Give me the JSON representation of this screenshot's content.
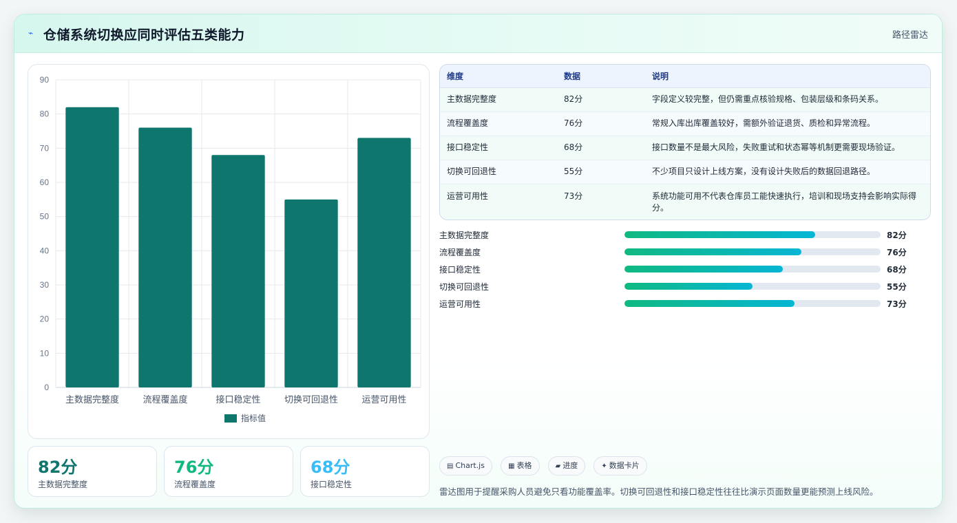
{
  "header": {
    "icon": "bolt-icon",
    "title": "仓储系统切换应同时评估五类能力",
    "tag": "路径雷达"
  },
  "chart_data": {
    "type": "bar",
    "categories": [
      "主数据完整度",
      "流程覆盖度",
      "接口稳定性",
      "切换可回退性",
      "运营可用性"
    ],
    "series": [
      {
        "name": "指标值",
        "values": [
          82,
          76,
          68,
          55,
          73
        ],
        "color": "#0f766e"
      }
    ],
    "ylim": [
      0,
      90
    ],
    "yticks": [
      0,
      10,
      20,
      30,
      40,
      50,
      60,
      70,
      80,
      90
    ],
    "grid": true,
    "legend": "bottom"
  },
  "stats": [
    {
      "value": "82分",
      "label": "主数据完整度",
      "color": "#0f766e"
    },
    {
      "value": "76分",
      "label": "流程覆盖度",
      "color": "#10b981"
    },
    {
      "value": "68分",
      "label": "接口稳定性",
      "color": "#38bdf8"
    }
  ],
  "table": {
    "headers": [
      "维度",
      "数据",
      "说明"
    ],
    "rows": [
      [
        "主数据完整度",
        "82分",
        "字段定义较完整，但仍需重点核验规格、包装层级和条码关系。"
      ],
      [
        "流程覆盖度",
        "76分",
        "常规入库出库覆盖较好，需额外验证退货、质检和异常流程。"
      ],
      [
        "接口稳定性",
        "68分",
        "接口数量不是最大风险，失败重试和状态幂等机制更需要现场验证。"
      ],
      [
        "切换可回退性",
        "55分",
        "不少项目只设计上线方案，没有设计失败后的数据回退路径。"
      ],
      [
        "运营可用性",
        "73分",
        "系统功能可用不代表仓库员工能快速执行，培训和现场支持会影响实际得分。"
      ]
    ]
  },
  "progress": [
    {
      "label": "主数据完整度",
      "value": 82,
      "text": "82分"
    },
    {
      "label": "流程覆盖度",
      "value": 76,
      "text": "76分"
    },
    {
      "label": "接口稳定性",
      "value": 68,
      "text": "68分"
    },
    {
      "label": "切换可回退性",
      "value": 55,
      "text": "55分"
    },
    {
      "label": "运营可用性",
      "value": 73,
      "text": "73分"
    }
  ],
  "progress_max": 110,
  "chips": [
    {
      "icon": "chart-icon",
      "label": "Chart.js"
    },
    {
      "icon": "table-icon",
      "label": "表格"
    },
    {
      "icon": "progress-icon",
      "label": "进度"
    },
    {
      "icon": "sparkle-icon",
      "label": "数据卡片"
    }
  ],
  "note": "雷达图用于提醒采购人员避免只看功能覆盖率。切换可回退性和接口稳定性往往比演示页面数量更能预测上线风险。"
}
